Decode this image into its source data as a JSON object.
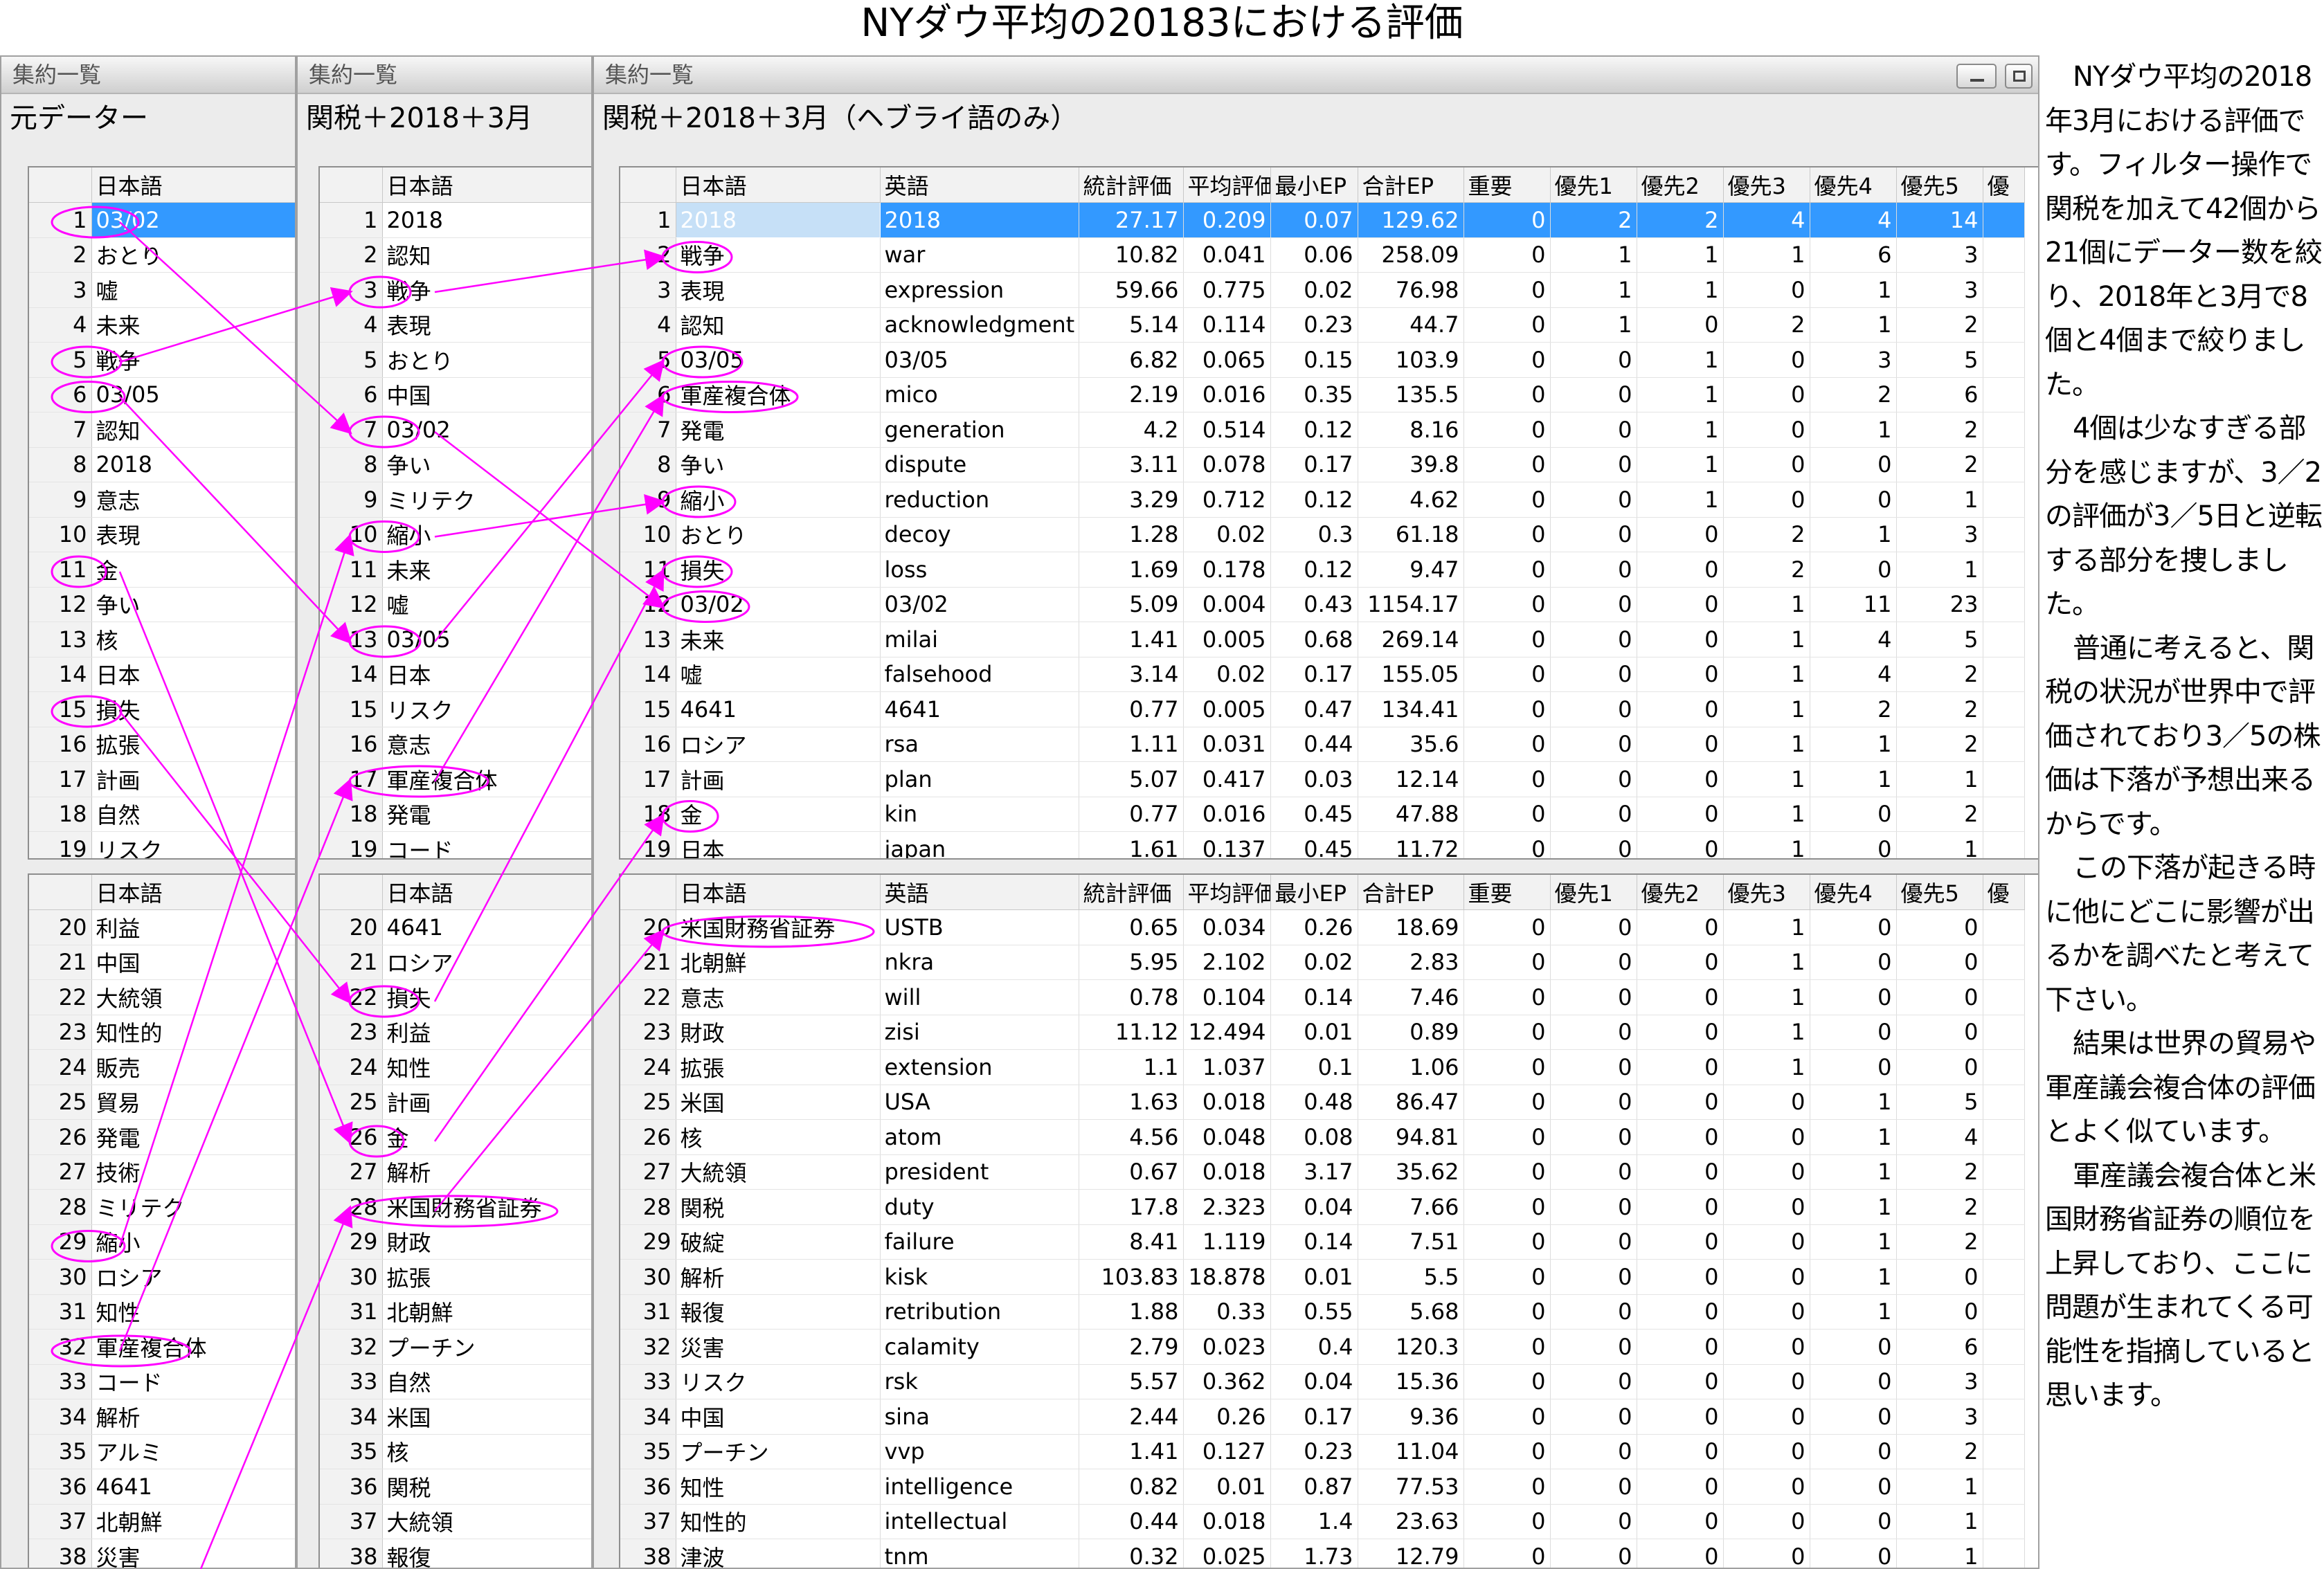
{
  "page_title": "NYダウ平均の20183における評価",
  "windows": [
    {
      "title": "集約一覧",
      "subtitle": "元データー",
      "col_header": "日本語",
      "top_rows": [
        [
          "1",
          "03/02"
        ],
        [
          "2",
          "おとり"
        ],
        [
          "3",
          "嘘"
        ],
        [
          "4",
          "未来"
        ],
        [
          "5",
          "戦争"
        ],
        [
          "6",
          "03/05"
        ],
        [
          "7",
          "認知"
        ],
        [
          "8",
          "2018"
        ],
        [
          "9",
          "意志"
        ],
        [
          "10",
          "表現"
        ],
        [
          "11",
          "金"
        ],
        [
          "12",
          "争い"
        ],
        [
          "13",
          "核"
        ],
        [
          "14",
          "日本"
        ],
        [
          "15",
          "損失"
        ],
        [
          "16",
          "拡張"
        ],
        [
          "17",
          "計画"
        ],
        [
          "18",
          "自然"
        ],
        [
          "19",
          "リスク"
        ]
      ],
      "bottom_rows": [
        [
          "20",
          "利益"
        ],
        [
          "21",
          "中国"
        ],
        [
          "22",
          "大統領"
        ],
        [
          "23",
          "知性的"
        ],
        [
          "24",
          "販売"
        ],
        [
          "25",
          "貿易"
        ],
        [
          "26",
          "発電"
        ],
        [
          "27",
          "技術"
        ],
        [
          "28",
          "ミリテク"
        ],
        [
          "29",
          "縮小"
        ],
        [
          "30",
          "ロシア"
        ],
        [
          "31",
          "知性"
        ],
        [
          "32",
          "軍産複合体"
        ],
        [
          "33",
          "コード"
        ],
        [
          "34",
          "解析"
        ],
        [
          "35",
          "アルミ"
        ],
        [
          "36",
          "4641"
        ],
        [
          "37",
          "北朝鮮"
        ],
        [
          "38",
          "災害"
        ]
      ]
    },
    {
      "title": "集約一覧",
      "subtitle": "関税＋2018＋3月",
      "col_header": "日本語",
      "top_rows": [
        [
          "1",
          "2018"
        ],
        [
          "2",
          "認知"
        ],
        [
          "3",
          "戦争"
        ],
        [
          "4",
          "表現"
        ],
        [
          "5",
          "おとり"
        ],
        [
          "6",
          "中国"
        ],
        [
          "7",
          "03/02"
        ],
        [
          "8",
          "争い"
        ],
        [
          "9",
          "ミリテク"
        ],
        [
          "10",
          "縮小"
        ],
        [
          "11",
          "未来"
        ],
        [
          "12",
          "嘘"
        ],
        [
          "13",
          "03/05"
        ],
        [
          "14",
          "日本"
        ],
        [
          "15",
          "リスク"
        ],
        [
          "16",
          "意志"
        ],
        [
          "17",
          "軍産複合体"
        ],
        [
          "18",
          "発電"
        ],
        [
          "19",
          "コード"
        ]
      ],
      "bottom_rows": [
        [
          "20",
          "4641"
        ],
        [
          "21",
          "ロシア"
        ],
        [
          "22",
          "損失"
        ],
        [
          "23",
          "利益"
        ],
        [
          "24",
          "知性"
        ],
        [
          "25",
          "計画"
        ],
        [
          "26",
          "金"
        ],
        [
          "27",
          "解析"
        ],
        [
          "28",
          "米国財務省証券"
        ],
        [
          "29",
          "財政"
        ],
        [
          "30",
          "拡張"
        ],
        [
          "31",
          "北朝鮮"
        ],
        [
          "32",
          "プーチン"
        ],
        [
          "33",
          "自然"
        ],
        [
          "34",
          "米国"
        ],
        [
          "35",
          "核"
        ],
        [
          "36",
          "関税"
        ],
        [
          "37",
          "大統領"
        ],
        [
          "38",
          "報復"
        ]
      ]
    },
    {
      "title": "集約一覧",
      "subtitle": "関税＋2018＋3月（ヘブライ語のみ）",
      "columns": [
        "日本語",
        "英語",
        "統計評価",
        "平均評価",
        "最小EP",
        "合計EP",
        "重要",
        "優先1",
        "優先2",
        "優先3",
        "優先4",
        "優先5",
        "優"
      ],
      "top_rows": [
        [
          "1",
          "2018",
          "2018",
          "27.17",
          "0.209",
          "0.07",
          "129.62",
          "0",
          "2",
          "2",
          "4",
          "4",
          "14"
        ],
        [
          "2",
          "戦争",
          "war",
          "10.82",
          "0.041",
          "0.06",
          "258.09",
          "0",
          "1",
          "1",
          "1",
          "6",
          "3"
        ],
        [
          "3",
          "表現",
          "expression",
          "59.66",
          "0.775",
          "0.02",
          "76.98",
          "0",
          "1",
          "1",
          "0",
          "1",
          "3"
        ],
        [
          "4",
          "認知",
          "acknowledgment",
          "5.14",
          "0.114",
          "0.23",
          "44.7",
          "0",
          "1",
          "0",
          "2",
          "1",
          "2"
        ],
        [
          "5",
          "03/05",
          "03/05",
          "6.82",
          "0.065",
          "0.15",
          "103.9",
          "0",
          "0",
          "1",
          "0",
          "3",
          "5"
        ],
        [
          "6",
          "軍産複合体",
          "mico",
          "2.19",
          "0.016",
          "0.35",
          "135.5",
          "0",
          "0",
          "1",
          "0",
          "2",
          "6"
        ],
        [
          "7",
          "発電",
          "generation",
          "4.2",
          "0.514",
          "0.12",
          "8.16",
          "0",
          "0",
          "1",
          "0",
          "1",
          "2"
        ],
        [
          "8",
          "争い",
          "dispute",
          "3.11",
          "0.078",
          "0.17",
          "39.8",
          "0",
          "0",
          "1",
          "0",
          "0",
          "2"
        ],
        [
          "9",
          "縮小",
          "reduction",
          "3.29",
          "0.712",
          "0.12",
          "4.62",
          "0",
          "0",
          "1",
          "0",
          "0",
          "1"
        ],
        [
          "10",
          "おとり",
          "decoy",
          "1.28",
          "0.02",
          "0.3",
          "61.18",
          "0",
          "0",
          "0",
          "2",
          "1",
          "3"
        ],
        [
          "11",
          "損失",
          "loss",
          "1.69",
          "0.178",
          "0.12",
          "9.47",
          "0",
          "0",
          "0",
          "2",
          "0",
          "1"
        ],
        [
          "12",
          "03/02",
          "03/02",
          "5.09",
          "0.004",
          "0.43",
          "1154.17",
          "0",
          "0",
          "0",
          "1",
          "11",
          "23"
        ],
        [
          "13",
          "未来",
          "milai",
          "1.41",
          "0.005",
          "0.68",
          "269.14",
          "0",
          "0",
          "0",
          "1",
          "4",
          "5"
        ],
        [
          "14",
          "嘘",
          "falsehood",
          "3.14",
          "0.02",
          "0.17",
          "155.05",
          "0",
          "0",
          "0",
          "1",
          "4",
          "2"
        ],
        [
          "15",
          "4641",
          "4641",
          "0.77",
          "0.005",
          "0.47",
          "134.41",
          "0",
          "0",
          "0",
          "1",
          "2",
          "2"
        ],
        [
          "16",
          "ロシア",
          "rsa",
          "1.11",
          "0.031",
          "0.44",
          "35.6",
          "0",
          "0",
          "0",
          "1",
          "1",
          "2"
        ],
        [
          "17",
          "計画",
          "plan",
          "5.07",
          "0.417",
          "0.03",
          "12.14",
          "0",
          "0",
          "0",
          "1",
          "1",
          "1"
        ],
        [
          "18",
          "金",
          "kin",
          "0.77",
          "0.016",
          "0.45",
          "47.88",
          "0",
          "0",
          "0",
          "1",
          "0",
          "2"
        ],
        [
          "19",
          "日本",
          "japan",
          "1.61",
          "0.137",
          "0.45",
          "11.72",
          "0",
          "0",
          "0",
          "1",
          "0",
          "1"
        ]
      ],
      "bottom_rows": [
        [
          "20",
          "米国財務省証券",
          "USTB",
          "0.65",
          "0.034",
          "0.26",
          "18.69",
          "0",
          "0",
          "0",
          "1",
          "0",
          "0"
        ],
        [
          "21",
          "北朝鮮",
          "nkra",
          "5.95",
          "2.102",
          "0.02",
          "2.83",
          "0",
          "0",
          "0",
          "1",
          "0",
          "0"
        ],
        [
          "22",
          "意志",
          "will",
          "0.78",
          "0.104",
          "0.14",
          "7.46",
          "0",
          "0",
          "0",
          "1",
          "0",
          "0"
        ],
        [
          "23",
          "財政",
          "zisi",
          "11.12",
          "12.494",
          "0.01",
          "0.89",
          "0",
          "0",
          "0",
          "1",
          "0",
          "0"
        ],
        [
          "24",
          "拡張",
          "extension",
          "1.1",
          "1.037",
          "0.1",
          "1.06",
          "0",
          "0",
          "0",
          "1",
          "0",
          "0"
        ],
        [
          "25",
          "米国",
          "USA",
          "1.63",
          "0.018",
          "0.48",
          "86.47",
          "0",
          "0",
          "0",
          "0",
          "1",
          "5"
        ],
        [
          "26",
          "核",
          "atom",
          "4.56",
          "0.048",
          "0.08",
          "94.81",
          "0",
          "0",
          "0",
          "0",
          "1",
          "4"
        ],
        [
          "27",
          "大統領",
          "president",
          "0.67",
          "0.018",
          "3.17",
          "35.62",
          "0",
          "0",
          "0",
          "0",
          "1",
          "2"
        ],
        [
          "28",
          "関税",
          "duty",
          "17.8",
          "2.323",
          "0.04",
          "7.66",
          "0",
          "0",
          "0",
          "0",
          "1",
          "2"
        ],
        [
          "29",
          "破綻",
          "failure",
          "8.41",
          "1.119",
          "0.14",
          "7.51",
          "0",
          "0",
          "0",
          "0",
          "1",
          "2"
        ],
        [
          "30",
          "解析",
          "kisk",
          "103.83",
          "18.878",
          "0.01",
          "5.5",
          "0",
          "0",
          "0",
          "0",
          "1",
          "0"
        ],
        [
          "31",
          "報復",
          "retribution",
          "1.88",
          "0.33",
          "0.55",
          "5.68",
          "0",
          "0",
          "0",
          "0",
          "1",
          "0"
        ],
        [
          "32",
          "災害",
          "calamity",
          "2.79",
          "0.023",
          "0.4",
          "120.3",
          "0",
          "0",
          "0",
          "0",
          "0",
          "6"
        ],
        [
          "33",
          "リスク",
          "rsk",
          "5.57",
          "0.362",
          "0.04",
          "15.36",
          "0",
          "0",
          "0",
          "0",
          "0",
          "3"
        ],
        [
          "34",
          "中国",
          "sina",
          "2.44",
          "0.26",
          "0.17",
          "9.36",
          "0",
          "0",
          "0",
          "0",
          "0",
          "3"
        ],
        [
          "35",
          "プーチン",
          "vvp",
          "1.41",
          "0.127",
          "0.23",
          "11.04",
          "0",
          "0",
          "0",
          "0",
          "0",
          "2"
        ],
        [
          "36",
          "知性",
          "intelligence",
          "0.82",
          "0.01",
          "0.87",
          "77.53",
          "0",
          "0",
          "0",
          "0",
          "0",
          "1"
        ],
        [
          "37",
          "知性的",
          "intellectual",
          "0.44",
          "0.018",
          "1.4",
          "23.63",
          "0",
          "0",
          "0",
          "0",
          "0",
          "1"
        ],
        [
          "38",
          "津波",
          "tnm",
          "0.32",
          "0.025",
          "1.73",
          "12.79",
          "0",
          "0",
          "0",
          "0",
          "0",
          "1"
        ]
      ]
    }
  ],
  "sidebar_paragraphs": [
    "NYダウ平均の2018年3月における評価です。フィルター操作で関税を加えて42個から21個にデーター数を絞り、2018年と3月で8個と4個まで絞りました。",
    "4個は少なすぎる部分を感じますが、3／2の評価が3／5日と逆転する部分を捜しました。",
    "普通に考えると、関税の状況が世界中で評価されており3／5の株価は下落が予想出来るからです。",
    "この下落が起きる時に他にどこに影響が出るかを調べたと考えて下さい。",
    "結果は世界の貿易や軍産議会複合体の評価とよく似ています。",
    "軍産議会複合体と米国財務省証券の順位を上昇しており、ここに問題が生まれてくる可能性を指摘していると思います。"
  ],
  "annotation_color": "#ff00ff",
  "selection_color": "#3399ff"
}
